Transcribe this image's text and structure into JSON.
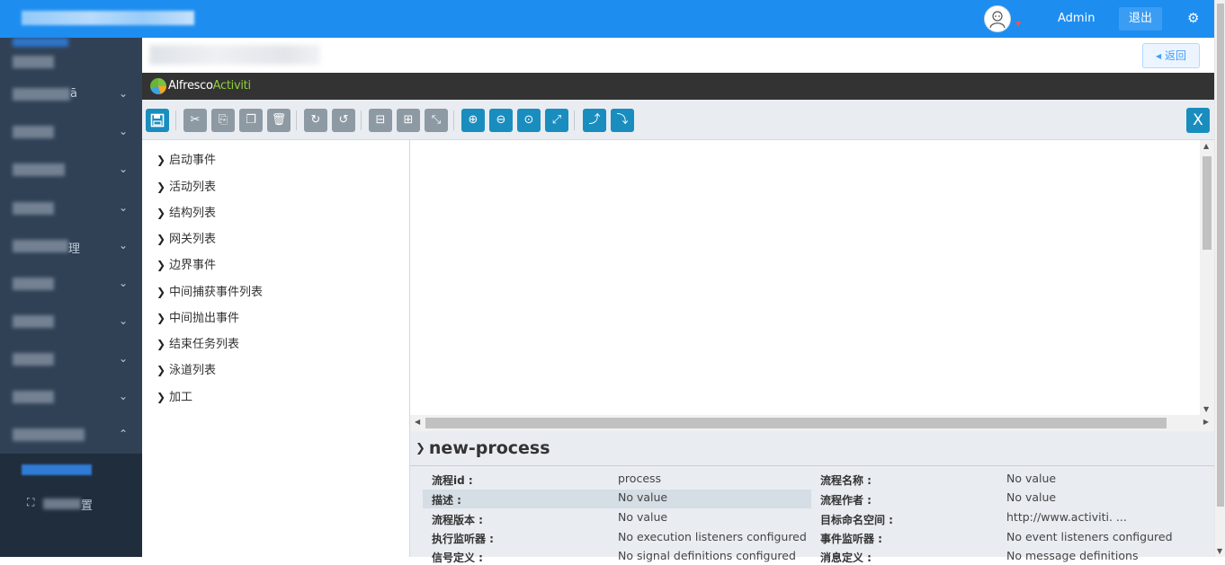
{
  "header": {
    "user": "Admin",
    "logout": "退出",
    "settings_icon": "gear-icon"
  },
  "sidebar": {
    "items": [
      {
        "tail": "",
        "chevron": "⌄"
      },
      {
        "tail": "ā",
        "chevron": "⌄"
      },
      {
        "tail": "",
        "chevron": "⌄"
      },
      {
        "tail": "",
        "chevron": "⌄"
      },
      {
        "tail": "理",
        "chevron": "⌄"
      },
      {
        "tail": "",
        "chevron": "⌄"
      },
      {
        "tail": "",
        "chevron": "⌄"
      },
      {
        "tail": "",
        "chevron": "⌄"
      },
      {
        "tail": "",
        "chevron": "⌄"
      },
      {
        "tail": "",
        "chevron": "⌃"
      }
    ],
    "sub_item_2_tail": "置"
  },
  "page": {
    "back": "返回"
  },
  "editor": {
    "logo_main": "Alfresco",
    "logo_sub": "Activiti",
    "close": "X",
    "palette": [
      "启动事件",
      "活动列表",
      "结构列表",
      "网关列表",
      "边界事件",
      "中间捕获事件列表",
      "中间抛出事件",
      "结束任务列表",
      "泳道列表",
      "加工"
    ]
  },
  "properties": {
    "title": "new-process",
    "rows": [
      {
        "l1": "流程id :",
        "v1": "process",
        "l2": "流程名称 :",
        "v2": "No value"
      },
      {
        "l1": "描述 :",
        "v1": "No value",
        "l2": "流程作者 :",
        "v2": "No value"
      },
      {
        "l1": "流程版本 :",
        "v1": "No value",
        "l2": "目标命名空间 :",
        "v2": "http://www.activiti. ..."
      },
      {
        "l1": "执行监听器 :",
        "v1": "No execution listeners configured",
        "l2": "事件监听器 :",
        "v2": "No event listeners configured"
      },
      {
        "l1": "信号定义 :",
        "v1": "No signal definitions configured",
        "l2": "消息定义 :",
        "v2": "No message definitions"
      }
    ]
  },
  "colors": {
    "topbar": "#1d8ef0",
    "sidebar": "#304156",
    "editor_head": "#333333",
    "toolbar_button": "#8e9aa3",
    "toolbar_zoom": "#1a8dbf"
  }
}
